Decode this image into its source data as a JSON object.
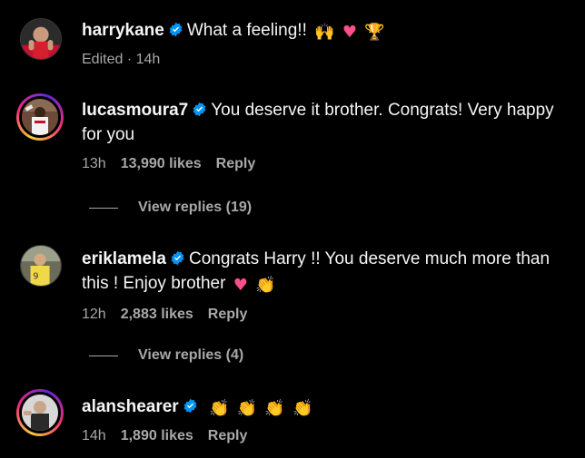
{
  "comments": [
    {
      "username": "harrykane",
      "text": "What a feeling!!",
      "emojis": [
        "raised-hands",
        "heart",
        "trophy"
      ],
      "time": "Edited · 14h",
      "likes": "",
      "reply_label": ""
    },
    {
      "username": "lucasmoura7",
      "text_line1": "You deserve it brother. Congrats! Very happy",
      "text_line2": "for you",
      "time": "13h",
      "likes": "13,990 likes",
      "reply_label": "Reply",
      "view_replies": "View replies (19)"
    },
    {
      "username": "eriklamela",
      "text_line1": "Congrats Harry !! You deserve much more than",
      "text_line2": "this ! Enjoy brother",
      "emojis": [
        "heart",
        "clapping-hands"
      ],
      "time": "12h",
      "likes": "2,883 likes",
      "reply_label": "Reply",
      "view_replies": "View replies (4)"
    },
    {
      "username": "alanshearer",
      "emojis": [
        "clapping-hands",
        "clapping-hands",
        "clapping-hands",
        "clapping-hands"
      ],
      "time": "14h",
      "likes": "1,890 likes",
      "reply_label": "Reply"
    }
  ],
  "colors": {
    "background": "#000000",
    "primary_text": "#f5f5f5",
    "secondary_text": "#a8a8a8",
    "verified_blue": "#0095f6"
  },
  "icons": {
    "verified": "verified-badge-icon"
  }
}
